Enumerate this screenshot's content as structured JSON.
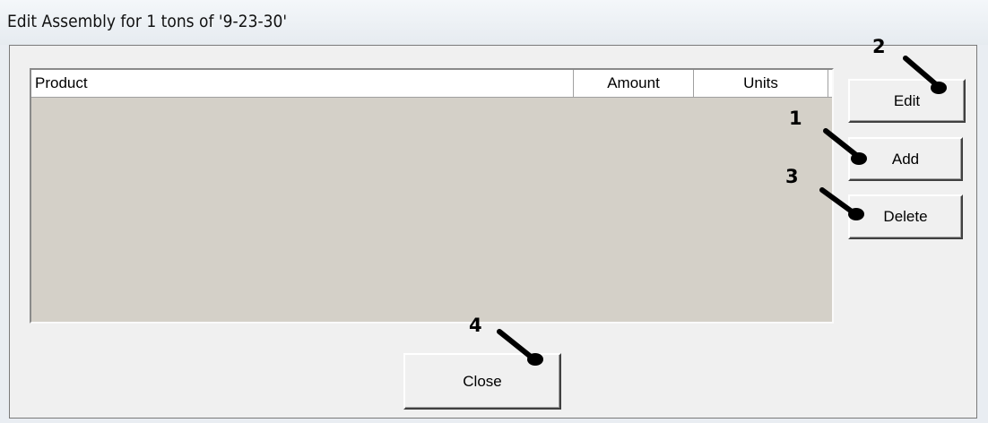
{
  "window": {
    "title": "Edit Assembly for 1 tons of '9-23-30'"
  },
  "table": {
    "columns": [
      {
        "label": "Product"
      },
      {
        "label": "Amount"
      },
      {
        "label": "Units"
      }
    ],
    "rows": []
  },
  "buttons": {
    "edit": "Edit",
    "add": "Add",
    "delete": "Delete",
    "close": "Close"
  },
  "callouts": {
    "add": "1",
    "edit": "2",
    "delete": "3",
    "close": "4"
  },
  "colors": {
    "list_background": "#d4d0c8",
    "dialog_background": "#f0f0f0",
    "callout_color": "#000000"
  }
}
